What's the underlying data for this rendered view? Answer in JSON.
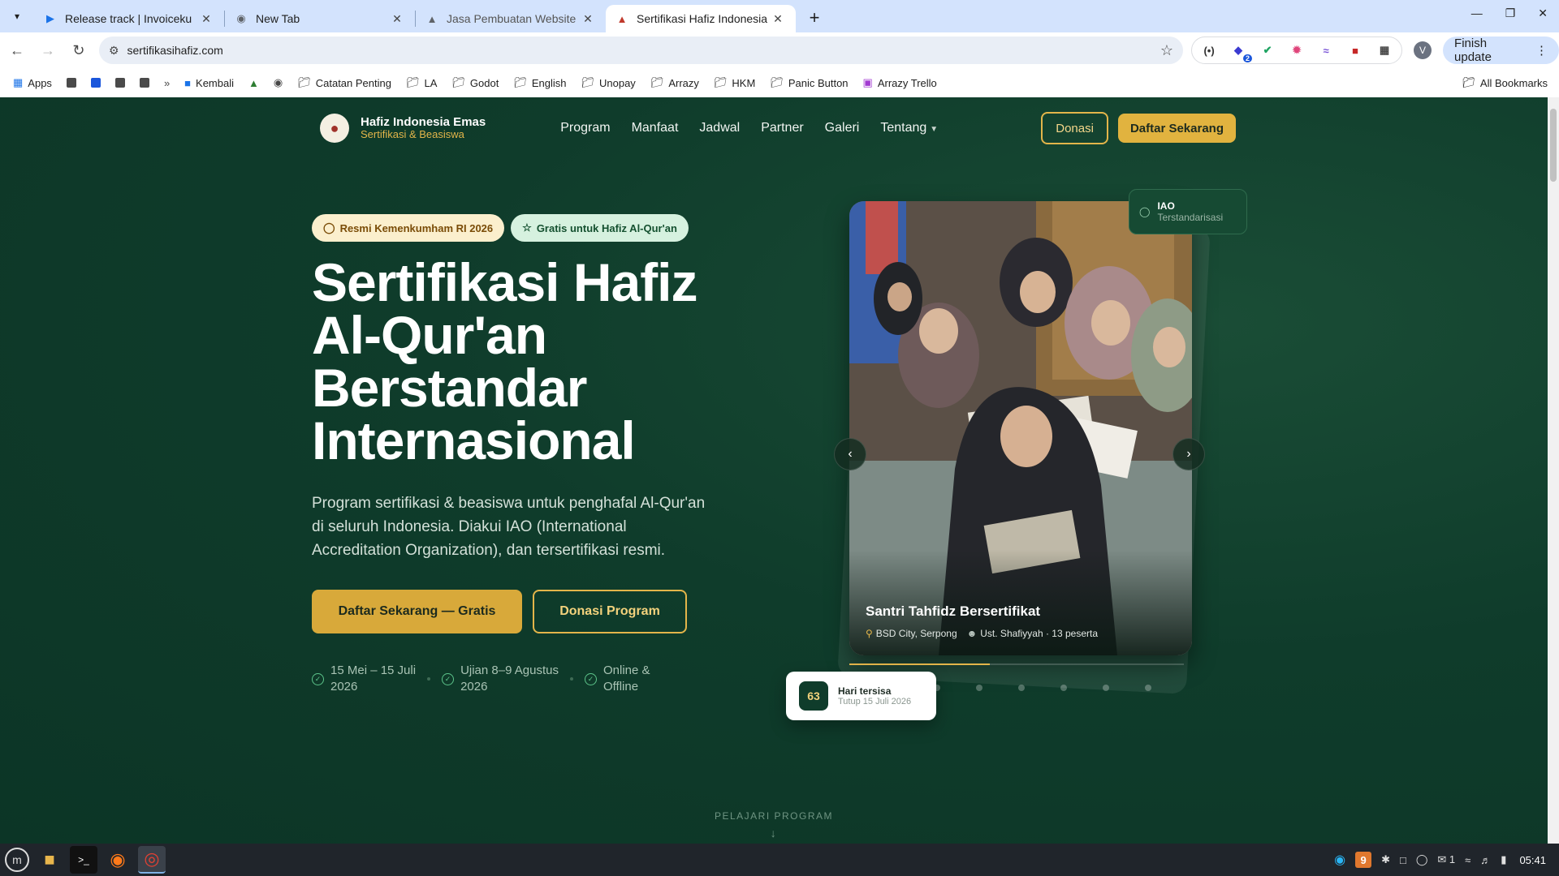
{
  "browser": {
    "tabs": [
      {
        "title": "Release track | Invoiceku",
        "icon": "play-console-icon",
        "active": false
      },
      {
        "title": "New Tab",
        "icon": "chrome-icon",
        "active": false
      },
      {
        "title": "Jasa Pembuatan Website Pe",
        "icon": "website-favicon",
        "active": false
      },
      {
        "title": "Sertifikasi Hafiz Indonesia En",
        "icon": "hafiz-favicon",
        "active": true
      }
    ],
    "url": "sertifikasihafiz.com",
    "finish_update": "Finish update",
    "profile_initial": "V",
    "extension_badge": "2",
    "bookmarks": [
      {
        "label": "Apps",
        "icon": "apps-grid-icon"
      },
      {
        "label": "",
        "icon": "bookmark-square-icon"
      },
      {
        "label": "",
        "icon": "bookmark-square-icon"
      },
      {
        "label": "",
        "icon": "bookmark-square-icon"
      },
      {
        "label": "",
        "icon": "bookmark-square-icon"
      },
      {
        "label": "Kembali",
        "icon": "kembali-icon"
      },
      {
        "label": "",
        "icon": "bookmark-site-icon"
      },
      {
        "label": "",
        "icon": "globe-icon"
      },
      {
        "label": "Catatan Penting",
        "icon": "folder-icon"
      },
      {
        "label": "LA",
        "icon": "folder-icon"
      },
      {
        "label": "Godot",
        "icon": "folder-icon"
      },
      {
        "label": "English",
        "icon": "folder-icon"
      },
      {
        "label": "Unopay",
        "icon": "folder-icon"
      },
      {
        "label": "Arrazy",
        "icon": "folder-icon"
      },
      {
        "label": "HKM",
        "icon": "folder-icon"
      },
      {
        "label": "Panic Button",
        "icon": "folder-icon"
      },
      {
        "label": "Arrazy Trello",
        "icon": "trello-icon"
      }
    ],
    "all_bookmarks": "All Bookmarks"
  },
  "site": {
    "brand_name": "Hafiz Indonesia Emas",
    "brand_tagline": "Sertifikasi & Beasiswa",
    "menu": [
      "Program",
      "Manfaat",
      "Jadwal",
      "Partner",
      "Galeri",
      "Tentang"
    ],
    "donate_label": "Donasi",
    "register_label": "Daftar Sekarang",
    "badges": [
      "Resmi Kemenkumham RI 2026",
      "Gratis untuk Hafiz Al-Qur'an"
    ],
    "hero_title_lines": [
      "Sertifikasi Hafiz",
      "Al-Qur'an",
      "Berstandar",
      "Internasional"
    ],
    "hero_description": "Program sertifikasi & beasiswa untuk penghafal Al-Qur'an di seluruh Indonesia. Diakui IAO (International Accreditation Organization), dan tersertifikasi resmi.",
    "cta_primary": "Daftar Sekarang — Gratis",
    "cta_secondary": "Donasi Program",
    "facts": [
      {
        "line1": "15 Mei – 15 Juli",
        "line2": "2026"
      },
      {
        "line1": "Ujian 8–9 Agustus",
        "line2": "2026"
      },
      {
        "line1": "Online &",
        "line2": "Offline"
      }
    ],
    "carousel": {
      "title": "Santri Tahfidz Bersertifikat",
      "location": "BSD City, Serpong",
      "teacher": "Ust. Shafiyyah · 13 peserta",
      "progress": 0.42,
      "slide_count": 6
    },
    "iao_badge": {
      "title": "IAO",
      "subtitle": "Terstandarisasi"
    },
    "countdown": {
      "days": "63",
      "label": "Hari tersisa",
      "sub": "Tutup 15 Juli 2026"
    },
    "scroll_cue": "PELAJARI PROGRAM"
  },
  "taskbar": {
    "tray_badge": "9",
    "notifications": "1",
    "time": "05:41"
  },
  "colors": {
    "page_bg": "#0e3b2a",
    "accent_gold": "#e1b33f",
    "tab_strip": "#d3e3fd"
  }
}
